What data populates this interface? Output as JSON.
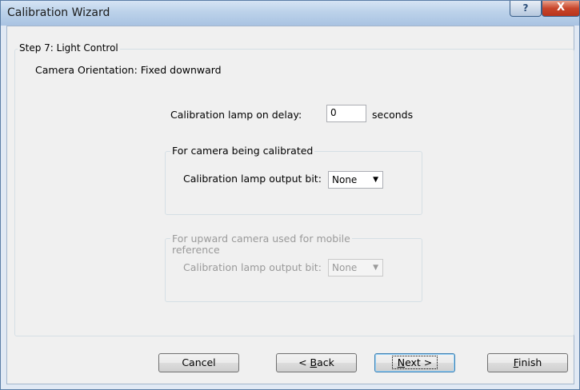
{
  "window": {
    "title": "Calibration Wizard",
    "help_label": "?",
    "close_label": "X"
  },
  "step": {
    "title": "Step 7: Light Control",
    "orientation": "Camera Orientation: Fixed downward"
  },
  "lamp_delay": {
    "label": "Calibration lamp on delay:",
    "value": "0",
    "unit": "seconds"
  },
  "calibrated_group": {
    "title": "For camera being calibrated",
    "output_label": "Calibration lamp output bit:",
    "output_value": "None"
  },
  "upward_group": {
    "title_line1": "For upward camera used for mobile",
    "title_line2": "reference",
    "output_label": "Calibration lamp output bit:",
    "output_value": "None"
  },
  "buttons": {
    "cancel": "Cancel",
    "back_prefix": "< ",
    "back_mnemonic": "B",
    "back_rest": "ack",
    "next_mnemonic": "N",
    "next_rest": "ext >",
    "finish_mnemonic": "F",
    "finish_rest": "inish"
  },
  "icons": {
    "dropdown": "chevron-down-icon",
    "help": "help-icon",
    "close": "close-icon"
  }
}
